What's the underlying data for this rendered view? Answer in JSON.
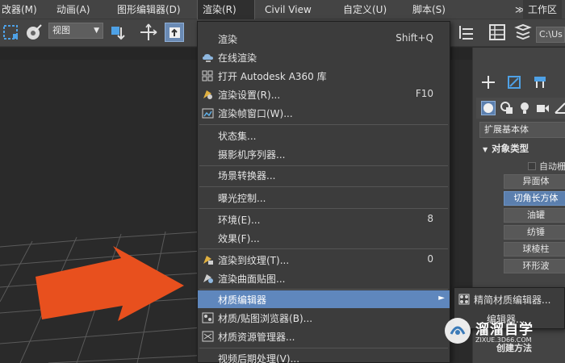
{
  "menubar": {
    "items": [
      {
        "label": "改器(M)"
      },
      {
        "label": "动画(A)"
      },
      {
        "label": "图形编辑器(D)"
      },
      {
        "label": "渲染(R)"
      },
      {
        "label": "Civil View"
      },
      {
        "label": "自定义(U)"
      },
      {
        "label": "脚本(S)"
      },
      {
        "label": "≫"
      },
      {
        "label": "工作区"
      }
    ]
  },
  "toolbar": {
    "view_select": "视图",
    "path_text": "C:\\Us"
  },
  "render_menu": {
    "items": [
      {
        "label": "渲染",
        "shortcut": "Shift+Q",
        "icon": ""
      },
      {
        "label": "在线渲染",
        "shortcut": "",
        "icon": "cloud-render-icon"
      },
      {
        "label": "打开 Autodesk A360 库",
        "shortcut": "",
        "icon": "a360-gallery-icon"
      },
      {
        "label": "渲染设置(R)...",
        "shortcut": "F10",
        "icon": "render-setup-icon"
      },
      {
        "label": "渲染帧窗口(W)...",
        "shortcut": "",
        "icon": "frame-window-icon"
      },
      {
        "label": "状态集...",
        "shortcut": "",
        "icon": ""
      },
      {
        "label": "摄影机序列器...",
        "shortcut": "",
        "icon": ""
      },
      {
        "label": "场景转换器...",
        "shortcut": "",
        "icon": ""
      },
      {
        "label": "曝光控制...",
        "shortcut": "",
        "icon": ""
      },
      {
        "label": "环境(E)...",
        "shortcut": "8",
        "icon": ""
      },
      {
        "label": "效果(F)...",
        "shortcut": "",
        "icon": ""
      },
      {
        "label": "渲染到纹理(T)...",
        "shortcut": "0",
        "icon": "render-to-texture-icon"
      },
      {
        "label": "渲染曲面贴图...",
        "shortcut": "",
        "icon": "surface-map-icon"
      },
      {
        "label": "材质编辑器",
        "shortcut": "",
        "icon": ""
      },
      {
        "label": "材质/贴图浏览器(B)...",
        "shortcut": "",
        "icon": "material-browser-icon"
      },
      {
        "label": "材质资源管理器...",
        "shortcut": "",
        "icon": "material-explorer-icon"
      },
      {
        "label": "视频后期处理(V)...",
        "shortcut": "",
        "icon": ""
      }
    ]
  },
  "submenu": {
    "items": [
      {
        "label": "精简材质编辑器..."
      },
      {
        "label": "编辑器..."
      }
    ]
  },
  "command_panel": {
    "category": "扩展基本体",
    "rollout_title": "对象类型",
    "autogrid_label": "自动栅",
    "object_types": [
      "异面体",
      "切角长方体",
      "油罐",
      "纺锤",
      "球棱柱",
      "环形波"
    ],
    "selected_type": "切角长方体",
    "bottom_label": "创建方法"
  },
  "watermark": {
    "title": "溜溜自学",
    "url": "ZIXUE.3D66.COM"
  },
  "colors": {
    "highlight": "#5f87bd",
    "arrow": "#e8501e",
    "menu_bg": "#3c3c3c",
    "toolbar_bg": "#444444"
  }
}
